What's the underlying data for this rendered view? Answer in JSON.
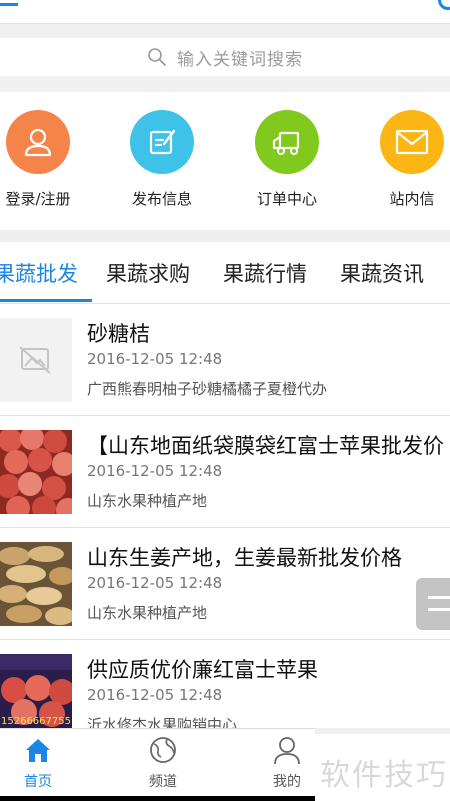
{
  "header": {
    "menu_icon": "menu-icon",
    "settings_icon": "gear-icon"
  },
  "search": {
    "placeholder": "输入关键词搜索",
    "icon": "search-icon"
  },
  "quick_actions": [
    {
      "label": "登录/注册",
      "icon": "user-icon",
      "color": "#f5844b"
    },
    {
      "label": "发布信息",
      "icon": "edit-icon",
      "color": "#3fc2e7"
    },
    {
      "label": "订单中心",
      "icon": "truck-icon",
      "color": "#82c91e"
    },
    {
      "label": "站内信",
      "icon": "envelope-icon",
      "color": "#fbb614"
    }
  ],
  "tabs": [
    {
      "label": "果蔬批发",
      "active": true
    },
    {
      "label": "果蔬求购",
      "active": false
    },
    {
      "label": "果蔬行情",
      "active": false
    },
    {
      "label": "果蔬资讯",
      "active": false
    }
  ],
  "listings": [
    {
      "title": "砂糖桔",
      "time": "2016-12-05 12:48",
      "source": "广西熊春明柚子砂糖橘橘子夏橙代办",
      "image": "placeholder-image-icon"
    },
    {
      "title": "【山东地面纸袋膜袋红富士苹果批发价",
      "time": "2016-12-05 12:48",
      "source": "山东水果种植产地",
      "image": "apples-photo"
    },
    {
      "title": "山东生姜产地，生姜最新批发价格",
      "time": "2016-12-05 12:48",
      "source": "山东水果种植产地",
      "image": "ginger-photo"
    },
    {
      "title": "供应质优价廉红富士苹果",
      "time": "2016-12-05 12:48",
      "source": "沂水修杰水果购销中心",
      "image": "apples-poster",
      "image_text": "15266667755"
    }
  ],
  "bottom_nav": [
    {
      "label": "首页",
      "icon": "home-icon",
      "active": true
    },
    {
      "label": "频道",
      "icon": "globe-icon",
      "active": false
    },
    {
      "label": "我的",
      "icon": "person-icon",
      "active": false
    }
  ],
  "watermark": "软件技巧",
  "colors": {
    "accent": "#1a86e6",
    "divider": "#e2e2e2",
    "background": "#f0f0f0"
  }
}
